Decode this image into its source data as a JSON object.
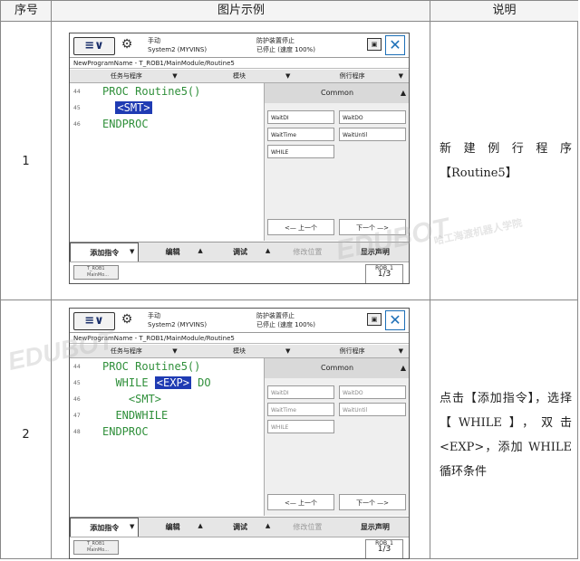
{
  "table": {
    "headers": {
      "col1": "序号",
      "col2": "图片示例",
      "col3": "说明"
    }
  },
  "rows": [
    {
      "number": "1",
      "description": "新建例行程序【Routine5】",
      "screen": {
        "status_left": [
          "手动",
          "System2 (MYVINS)"
        ],
        "status_right": [
          "防护装置停止",
          "已停止 (速度 100%)"
        ],
        "path": "NewProgramName - T_ROB1/MainModule/Routine5",
        "tabs": [
          "任务与程序",
          "模块",
          "例行程序"
        ],
        "line_numbers": [
          "44",
          "45",
          "46"
        ],
        "code": [
          {
            "pre": "PROC Routine5()",
            "hl": "",
            "post": ""
          },
          {
            "pre": "  ",
            "hl": "<SMT>",
            "post": ""
          },
          {
            "pre": "ENDPROC",
            "hl": "",
            "post": ""
          }
        ],
        "panel_title": "Common",
        "panel_buttons": [
          "WaitDI",
          "WaitDO",
          "WaitTime",
          "WaitUntil",
          "WHILE"
        ],
        "prev": "<— 上一个",
        "next": "下一个 —>",
        "bottom_buttons": [
          "添加指令",
          "编辑",
          "调试",
          "修改位置",
          "显示声明"
        ],
        "task_label": [
          "T_ROB1",
          "MainMo..."
        ],
        "rob_label": [
          "ROB_1",
          "1/3"
        ]
      }
    },
    {
      "number": "2",
      "description": "点击【添加指令】，选择【WHILE】，双击<EXP>，添加 WHILE 循环条件",
      "screen": {
        "status_left": [
          "手动",
          "System2 (MYVINS)"
        ],
        "status_right": [
          "防护装置停止",
          "已停止 (速度 100%)"
        ],
        "path": "NewProgramName - T_ROB1/MainModule/Routine5",
        "tabs": [
          "任务与程序",
          "模块",
          "例行程序"
        ],
        "line_numbers": [
          "44",
          "45",
          "46",
          "47",
          "48"
        ],
        "code": [
          {
            "pre": "PROC Routine5()",
            "hl": "",
            "post": ""
          },
          {
            "pre": "  WHILE ",
            "hl": "<EXP>",
            "post": " DO"
          },
          {
            "pre": "    <SMT>",
            "hl": "",
            "post": ""
          },
          {
            "pre": "  ENDWHILE",
            "hl": "",
            "post": ""
          },
          {
            "pre": "ENDPROC",
            "hl": "",
            "post": ""
          }
        ],
        "panel_title": "Common",
        "panel_buttons": [
          "WaitDI",
          "WaitDO",
          "WaitTime",
          "WaitUntil",
          "WHILE"
        ],
        "prev": "<— 上一个",
        "next": "下一个 —>",
        "bottom_buttons": [
          "添加指令",
          "编辑",
          "调试",
          "修改位置",
          "显示声明"
        ],
        "task_label": [
          "T_ROB1",
          "MainMo..."
        ],
        "rob_label": [
          "ROB_1",
          "1/3"
        ]
      }
    }
  ],
  "watermarks": [
    "EDUBOT",
    "EDUBOT",
    "哈工海渡机器人学院"
  ]
}
